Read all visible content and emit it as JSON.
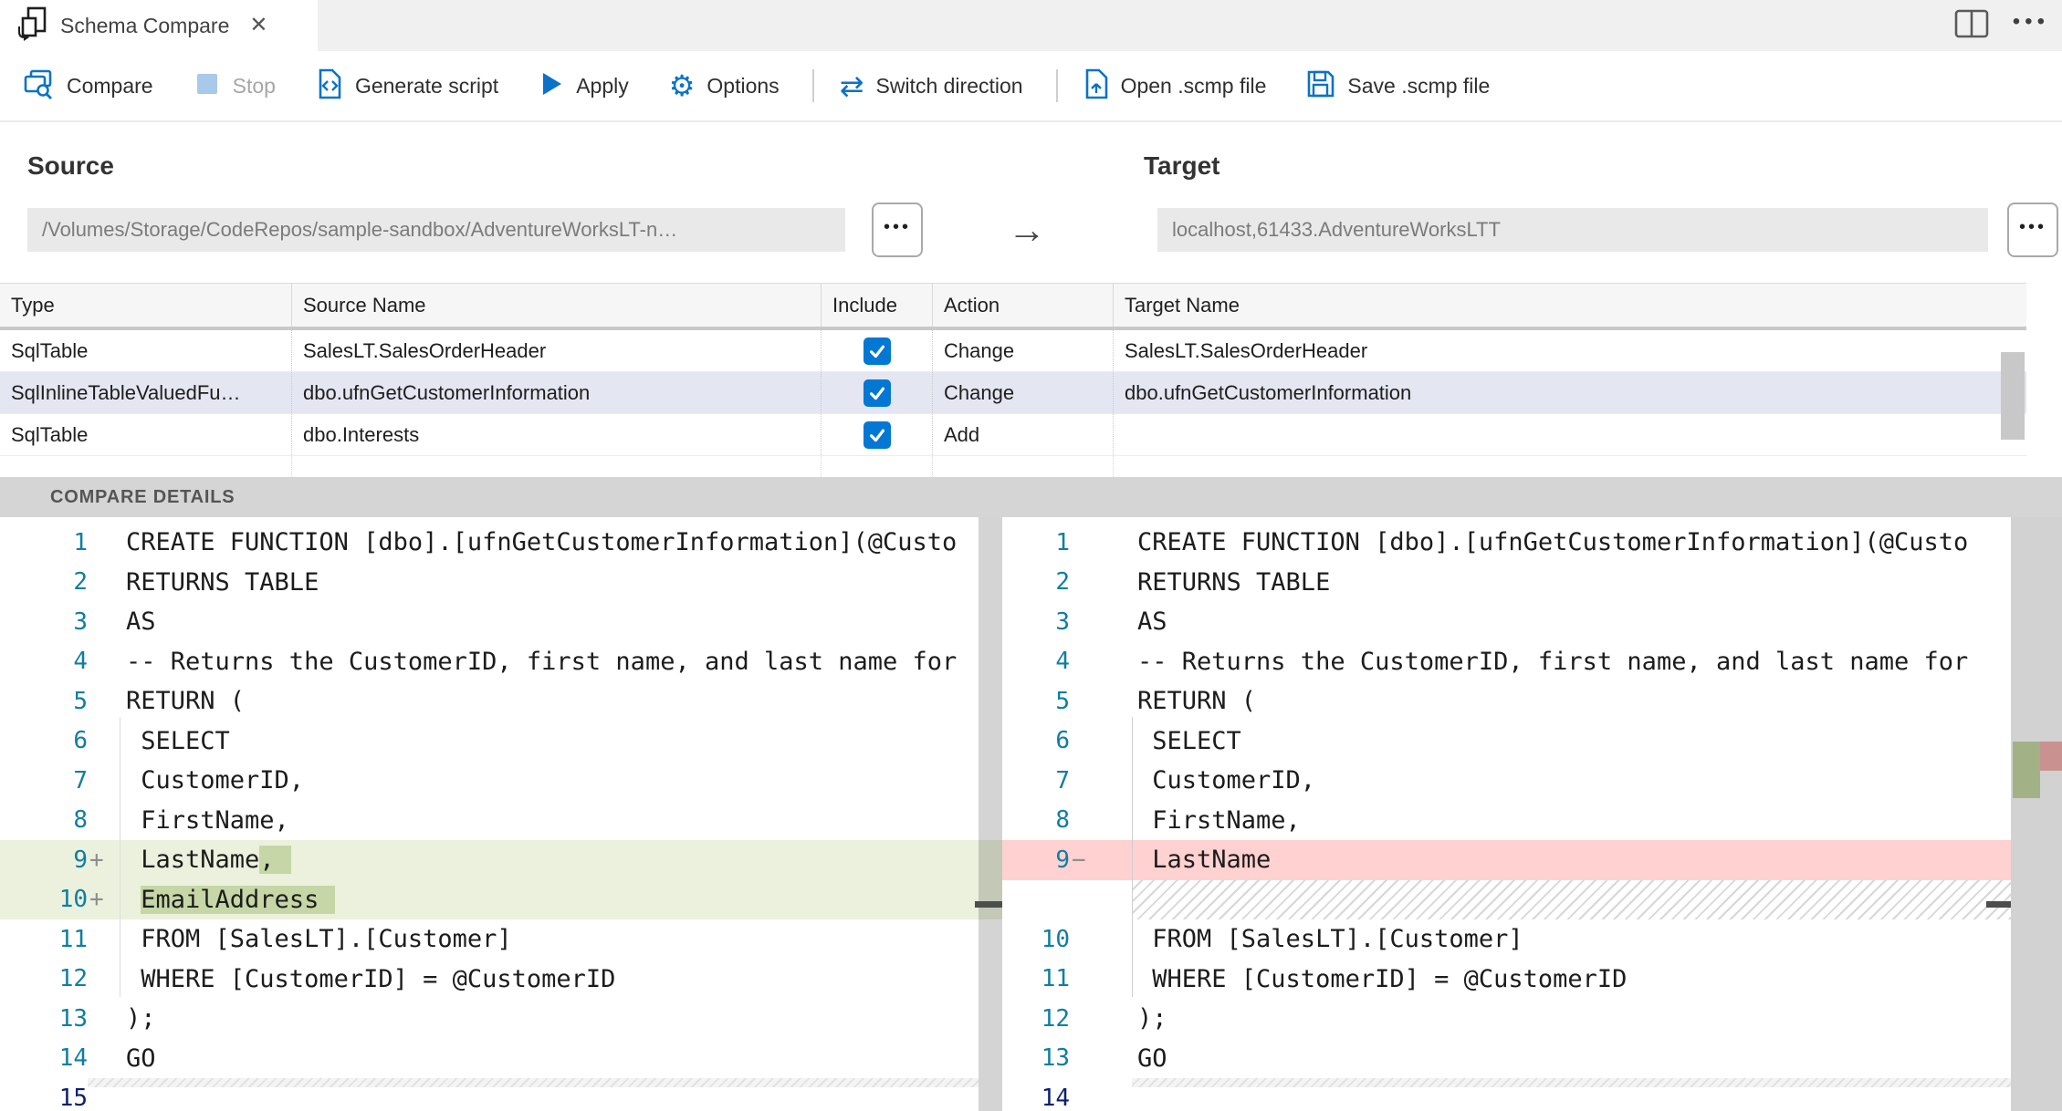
{
  "tab": {
    "title": "Schema Compare",
    "close_glyph": "✕"
  },
  "window": {
    "more_glyph": "•••"
  },
  "toolbar": {
    "compare": {
      "label": "Compare"
    },
    "stop": {
      "label": "Stop",
      "disabled": true
    },
    "generate": {
      "label": "Generate script"
    },
    "apply": {
      "label": "Apply"
    },
    "options": {
      "label": "Options",
      "glyph": "⚙"
    },
    "switch": {
      "label": "Switch direction",
      "glyph": "⇄"
    },
    "open": {
      "label": "Open .scmp file"
    },
    "save": {
      "label": "Save .scmp file"
    }
  },
  "source": {
    "heading": "Source",
    "value": "/Volumes/Storage/CodeRepos/sample-sandbox/AdventureWorksLT-n…",
    "browse_glyph": "•••"
  },
  "target": {
    "heading": "Target",
    "value": "localhost,61433.AdventureWorksLTT",
    "browse_glyph": "•••"
  },
  "direction_arrow": "→",
  "grid": {
    "columns": [
      "Type",
      "Source Name",
      "Include",
      "Action",
      "Target Name"
    ],
    "rows": [
      {
        "type": "SqlTable",
        "source_name": "SalesLT.SalesOrderHeader",
        "include": true,
        "action": "Change",
        "target_name": "SalesLT.SalesOrderHeader",
        "selected": false
      },
      {
        "type": "SqlInlineTableValuedFu…",
        "source_name": "dbo.ufnGetCustomerInformation",
        "include": true,
        "action": "Change",
        "target_name": "dbo.ufnGetCustomerInformation",
        "selected": true
      },
      {
        "type": "SqlTable",
        "source_name": "dbo.Interests",
        "include": true,
        "action": "Add",
        "target_name": "",
        "selected": false
      }
    ]
  },
  "details": {
    "heading": "COMPARE DETAILS"
  },
  "diff": {
    "left": [
      {
        "n": "1",
        "t": "CREATE FUNCTION [dbo].[ufnGetCustomerInformation](@Custo"
      },
      {
        "n": "2",
        "t": "RETURNS TABLE"
      },
      {
        "n": "3",
        "t": "AS"
      },
      {
        "n": "4",
        "t": "-- Returns the CustomerID, first name, and last name for"
      },
      {
        "n": "5",
        "t": "RETURN ("
      },
      {
        "n": "6",
        "t": " SELECT"
      },
      {
        "n": "7",
        "t": " CustomerID,"
      },
      {
        "n": "8",
        "t": " FirstName,"
      },
      {
        "n": "9",
        "kind": "add",
        "marker": "+",
        "segs": [
          {
            "t": " LastName"
          },
          {
            "t": ",",
            "hl": true
          }
        ]
      },
      {
        "n": "10",
        "kind": "add",
        "marker": "+",
        "segs": [
          {
            "t": " "
          },
          {
            "t": "EmailAddress",
            "hl": true
          }
        ]
      },
      {
        "n": "11",
        "t": " FROM [SalesLT].[Customer]"
      },
      {
        "n": "12",
        "t": " WHERE [CustomerID] = @CustomerID"
      },
      {
        "n": "13",
        "t": ");"
      },
      {
        "n": "14",
        "t": "GO"
      },
      {
        "n": "15",
        "t": "",
        "active": true
      }
    ],
    "right": [
      {
        "n": "1",
        "t": "CREATE FUNCTION [dbo].[ufnGetCustomerInformation](@Custo"
      },
      {
        "n": "2",
        "t": "RETURNS TABLE"
      },
      {
        "n": "3",
        "t": "AS"
      },
      {
        "n": "4",
        "t": "-- Returns the CustomerID, first name, and last name for"
      },
      {
        "n": "5",
        "t": "RETURN ("
      },
      {
        "n": "6",
        "t": " SELECT"
      },
      {
        "n": "7",
        "t": " CustomerID,"
      },
      {
        "n": "8",
        "t": " FirstName,"
      },
      {
        "n": "9",
        "kind": "del",
        "marker": "−",
        "t": " LastName"
      },
      {
        "kind": "spacer"
      },
      {
        "n": "10",
        "t": " FROM [SalesLT].[Customer]"
      },
      {
        "n": "11",
        "t": " WHERE [CustomerID] = @CustomerID"
      },
      {
        "n": "12",
        "t": ");"
      },
      {
        "n": "13",
        "t": "GO"
      },
      {
        "n": "14",
        "t": "",
        "active": true
      }
    ]
  },
  "colors": {
    "accent_blue": "#0a72c8",
    "checkbox_blue": "#0277d4",
    "insert_line": "rgba(155,185,85,0.20)",
    "insert_char": "rgba(140,170,75,0.38)",
    "delete_line": "rgba(255,0,0,0.18)",
    "selected_row": "#e4e6f1",
    "line_number": "#0e7ea3"
  }
}
